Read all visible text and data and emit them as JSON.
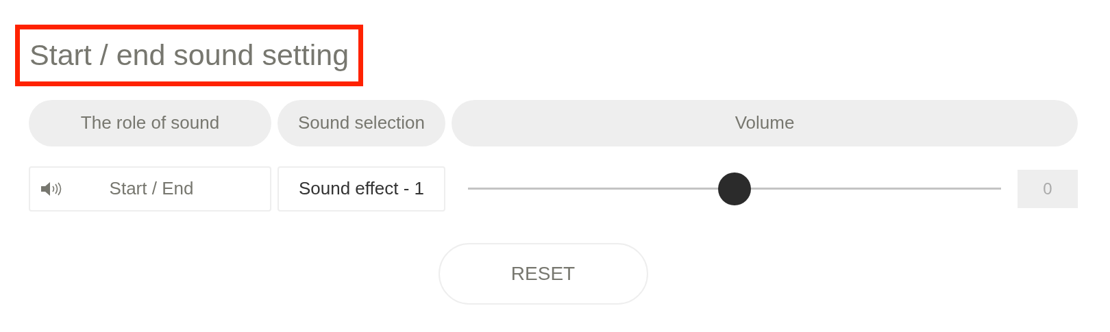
{
  "title": {
    "text": "Start / end sound setting",
    "highlighted": true
  },
  "columns": [
    "The role of sound",
    "Sound selection",
    "Volume"
  ],
  "rows": [
    {
      "role": "Start / End",
      "sound": "Sound effect - 1",
      "level": 0.5,
      "reading": "0"
    }
  ],
  "reset_button": "RESET"
}
